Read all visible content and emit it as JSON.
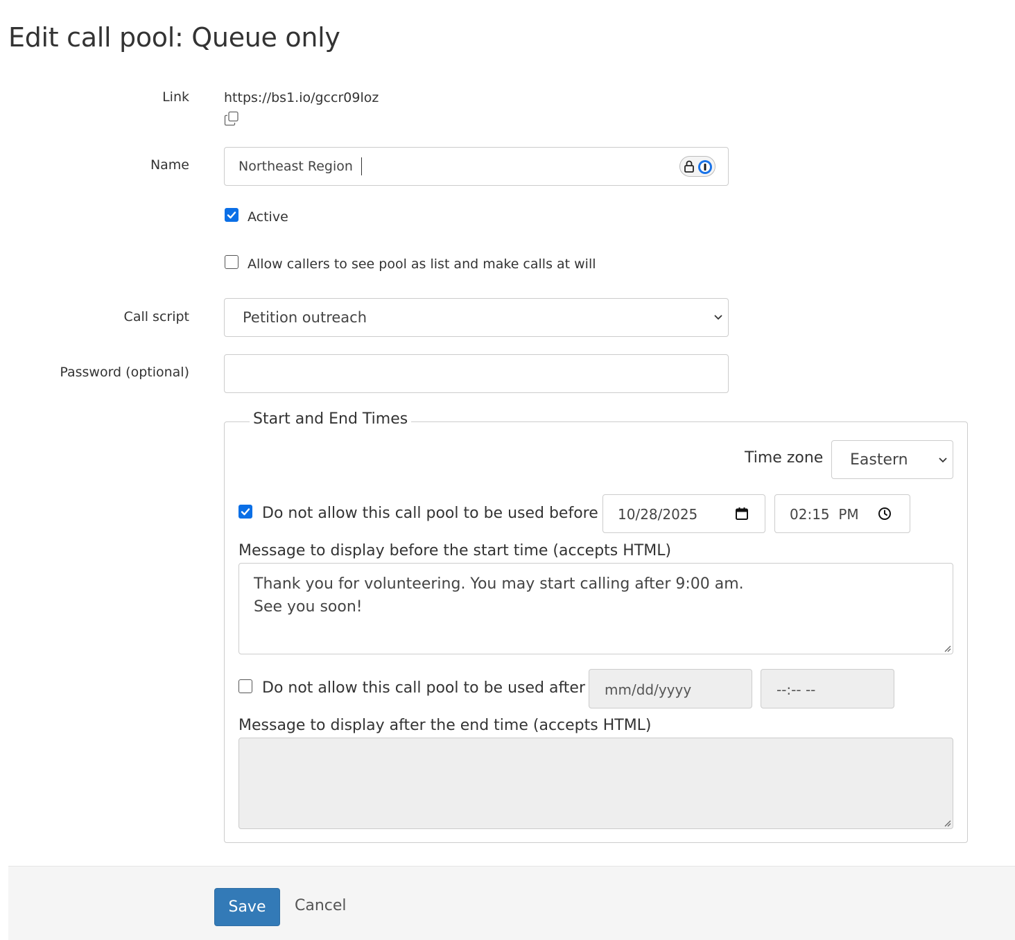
{
  "page": {
    "title": "Edit call pool: Queue only"
  },
  "form": {
    "link": {
      "label": "Link",
      "value": "https://bs1.io/gccr09loz"
    },
    "name": {
      "label": "Name",
      "value": "Northeast Region"
    },
    "active": {
      "label": "Active",
      "checked": true
    },
    "allow_list": {
      "label": "Allow callers to see pool as list and make calls at will",
      "checked": false
    },
    "call_script": {
      "label": "Call script",
      "selected": "Petition outreach"
    },
    "password": {
      "label": "Password (optional)",
      "value": ""
    }
  },
  "times": {
    "legend": "Start and End Times",
    "timezone": {
      "label": "Time zone",
      "selected": "Eastern"
    },
    "start": {
      "label": "Do not allow this call pool to be used before",
      "checked": true,
      "date": "10/28/2025",
      "time": "02:15  PM",
      "message_label": "Message to display before the start time (accepts HTML)",
      "message_line1": "Thank you for volunteering. You may start calling after 9:00 am.",
      "message_line2": "See you soon!"
    },
    "end": {
      "label": "Do not allow this call pool to be used after",
      "checked": false,
      "date_placeholder": "mm/dd/yyyy",
      "time_placeholder": "--:-- --",
      "message_label": "Message to display after the end time (accepts HTML)",
      "message": ""
    }
  },
  "footer": {
    "save_label": "Save",
    "cancel_label": "Cancel"
  },
  "colors": {
    "primary": "#337ab7",
    "checkbox_accent": "#0b6fe6",
    "disabled_bg": "#eeeeee"
  }
}
